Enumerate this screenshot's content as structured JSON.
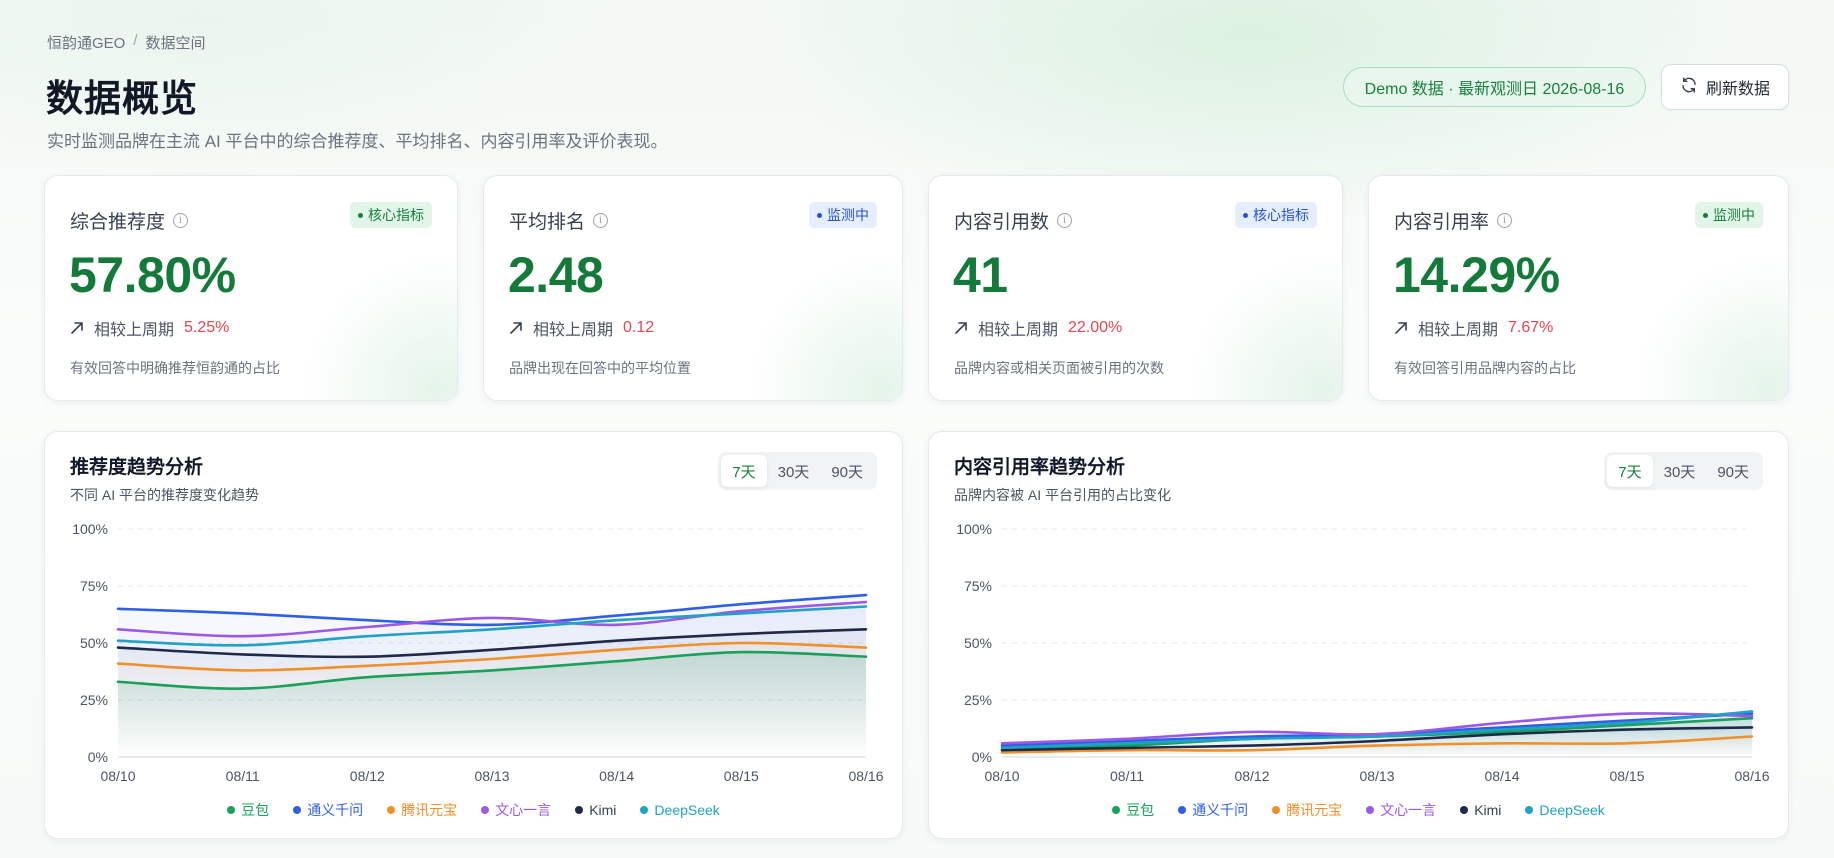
{
  "breadcrumb": {
    "root": "恒韵通GEO",
    "separator": "/",
    "current": "数据空间"
  },
  "header": {
    "title": "数据概览",
    "subtitle": "实时监测品牌在主流 AI 平台中的综合推荐度、平均排名、内容引用率及评价表现。",
    "demo_badge": "Demo 数据 · 最新观测日 2026-08-16",
    "refresh_label": "刷新数据"
  },
  "metrics": [
    {
      "title": "综合推荐度",
      "tag": "核心指标",
      "tag_color": "green",
      "value": "57.80%",
      "compare_label": "相较上周期",
      "delta": "5.25%",
      "desc": "有效回答中明确推荐恒韵通的占比"
    },
    {
      "title": "平均排名",
      "tag": "监测中",
      "tag_color": "blue",
      "value": "2.48",
      "compare_label": "相较上周期",
      "delta": "0.12",
      "desc": "品牌出现在回答中的平均位置"
    },
    {
      "title": "内容引用数",
      "tag": "核心指标",
      "tag_color": "blue",
      "value": "41",
      "compare_label": "相较上周期",
      "delta": "22.00%",
      "desc": "品牌内容或相关页面被引用的次数"
    },
    {
      "title": "内容引用率",
      "tag": "监测中",
      "tag_color": "green",
      "value": "14.29%",
      "compare_label": "相较上周期",
      "delta": "7.67%",
      "desc": "有效回答引用品牌内容的占比"
    }
  ],
  "range_tabs": [
    "7天",
    "30天",
    "90天"
  ],
  "active_range": "7天",
  "chart_data": [
    {
      "type": "line",
      "title": "推荐度趋势分析",
      "subtitle": "不同 AI 平台的推荐度变化趋势",
      "x": [
        "08/10",
        "08/11",
        "08/12",
        "08/13",
        "08/14",
        "08/15",
        "08/16"
      ],
      "yticks": [
        "0%",
        "25%",
        "50%",
        "75%",
        "100%"
      ],
      "ylim": [
        0,
        100
      ],
      "grid": true,
      "legend_position": "bottom",
      "series": [
        {
          "name": "豆包",
          "color": "#1aa05a",
          "values": [
            33,
            30,
            35,
            38,
            42,
            46,
            44
          ]
        },
        {
          "name": "通义千问",
          "color": "#2f5fe6",
          "values": [
            65,
            63,
            60,
            58,
            62,
            67,
            71
          ]
        },
        {
          "name": "腾讯元宝",
          "color": "#f0902a",
          "values": [
            41,
            38,
            40,
            43,
            47,
            50,
            48
          ]
        },
        {
          "name": "文心一言",
          "color": "#9b59e6",
          "values": [
            56,
            53,
            57,
            61,
            58,
            64,
            68
          ]
        },
        {
          "name": "Kimi",
          "color": "#1e2a4a",
          "values": [
            48,
            45,
            44,
            47,
            51,
            54,
            56
          ]
        },
        {
          "name": "DeepSeek",
          "color": "#1fa2c4",
          "values": [
            51,
            49,
            53,
            56,
            60,
            63,
            66
          ]
        }
      ]
    },
    {
      "type": "line",
      "title": "内容引用率趋势分析",
      "subtitle": "品牌内容被 AI 平台引用的占比变化",
      "x": [
        "08/10",
        "08/11",
        "08/12",
        "08/13",
        "08/14",
        "08/15",
        "08/16"
      ],
      "yticks": [
        "0%",
        "25%",
        "50%",
        "75%",
        "100%"
      ],
      "ylim": [
        0,
        100
      ],
      "grid": true,
      "legend_position": "bottom",
      "series": [
        {
          "name": "豆包",
          "color": "#1aa05a",
          "values": [
            4,
            5,
            8,
            9,
            11,
            14,
            17
          ]
        },
        {
          "name": "通义千问",
          "color": "#2f5fe6",
          "values": [
            5,
            7,
            9,
            10,
            13,
            16,
            19
          ]
        },
        {
          "name": "腾讯元宝",
          "color": "#f0902a",
          "values": [
            2,
            3,
            3,
            5,
            6,
            6,
            9
          ]
        },
        {
          "name": "文心一言",
          "color": "#9b59e6",
          "values": [
            6,
            8,
            11,
            10,
            15,
            19,
            18
          ]
        },
        {
          "name": "Kimi",
          "color": "#1e2a4a",
          "values": [
            3,
            4,
            5,
            7,
            10,
            12,
            13
          ]
        },
        {
          "name": "DeepSeek",
          "color": "#1fa2c4",
          "values": [
            4,
            6,
            8,
            9,
            12,
            15,
            20
          ]
        }
      ]
    }
  ]
}
